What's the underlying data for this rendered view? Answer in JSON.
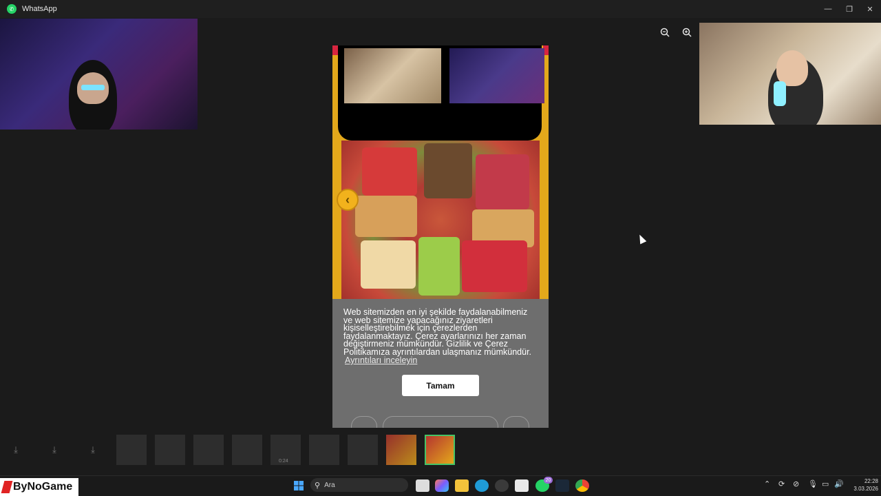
{
  "window": {
    "title": "WhatsApp",
    "minimize_glyph": "—",
    "restore_glyph": "❐",
    "close_glyph": "✕"
  },
  "viewer": {
    "zoom_out_icon": "zoom-out-icon",
    "zoom_in_icon": "zoom-in-icon",
    "prev_glyph": "‹",
    "cookie_banner": {
      "text": "Web sitemizden en iyi şekilde faydalanabilmeniz ve web sitemize yapacağınız ziyaretleri kişiselleştirebilmek için çerezlerden faydalanmaktayız. Çerez ayarlarınızı her zaman değiştirmeniz mümkündür. Gizlilik ve Çerez Politikamıza ayrıntılardan ulaşmanız mümkündür.",
      "link": "Ayrıntıları inceleyin",
      "ok_button": "Tamam"
    }
  },
  "media_strip": {
    "download_glyph": "⤓",
    "video_duration": "0:24"
  },
  "taskbar": {
    "brand": "ByNoGame",
    "search_placeholder": "Ara",
    "whatsapp_badge": "20",
    "time": "22:28",
    "date": "3.03.2026"
  },
  "colors": {
    "accent_green": "#45c467",
    "banner_gray": "#6e6e6e",
    "viewer_yellow": "#e3a81b"
  }
}
